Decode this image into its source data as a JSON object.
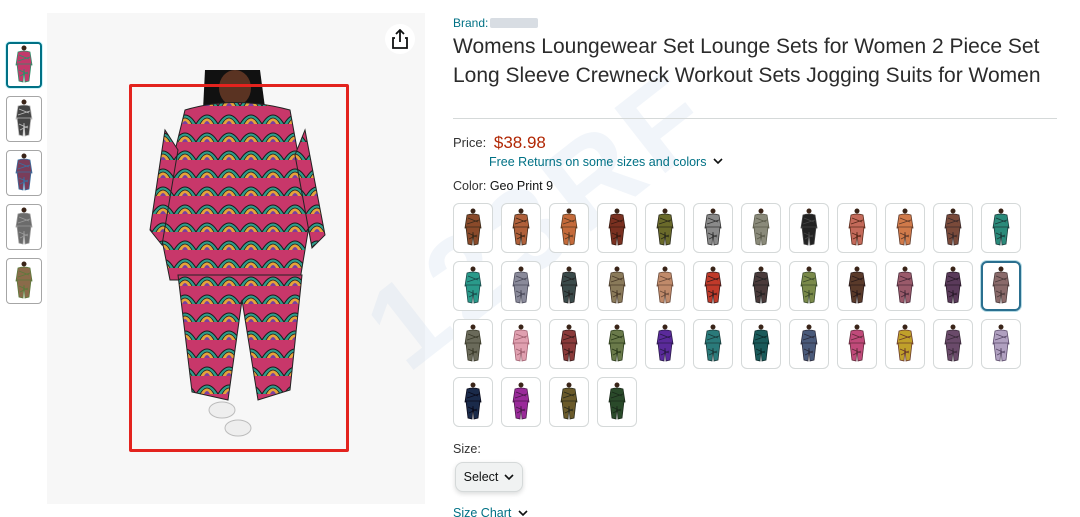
{
  "thumbnails": [
    {
      "name": "thumb-1",
      "colors": [
        "#c23a6b",
        "#2f8f6a",
        "#e0a232"
      ]
    },
    {
      "name": "thumb-2",
      "colors": [
        "#444",
        "#bbb",
        "#777"
      ]
    },
    {
      "name": "thumb-3",
      "colors": [
        "#7a3d5a",
        "#3b6fa0",
        "#d8b14a"
      ]
    },
    {
      "name": "thumb-4",
      "colors": [
        "#6b6b6b",
        "#999",
        "#444"
      ]
    },
    {
      "name": "thumb-5",
      "colors": [
        "#8a6b4a",
        "#5c7a3c",
        "#b94a3a"
      ]
    }
  ],
  "share_icon": "share-icon",
  "product": {
    "brand_label": "Brand:",
    "title": "Womens Loungewear Set Lounge Sets for Women 2 Piece Set Long Sleeve Crewneck Workout Sets Jogging Suits for Women",
    "price_label": "Price:",
    "price": "$38.98",
    "returns_text": "Free Returns on some sizes and colors",
    "color_label": "Color:",
    "color_value": "Geo Print 9",
    "size_label": "Size:",
    "size_select_value": "Select",
    "size_chart_link": "Size Chart",
    "selected_swatch_index": 23
  },
  "swatches": [
    [
      "#8a4a2a",
      "#3a2a1a"
    ],
    [
      "#b0603a",
      "#402818"
    ],
    [
      "#c46a3a",
      "#5a3a20"
    ],
    [
      "#7a3020",
      "#3a1a10"
    ],
    [
      "#6a6a2a",
      "#2a2a1a"
    ],
    [
      "#8a8a8a",
      "#333"
    ],
    [
      "#8a8a7a",
      "#5a5a4a"
    ],
    [
      "#222",
      "#444"
    ],
    [
      "#c46a5a",
      "#5a2a1a"
    ],
    [
      "#d07a4a",
      "#603a2a"
    ],
    [
      "#7a4a3a",
      "#3a2a2a"
    ],
    [
      "#2a8a7a",
      "#1a3a3a"
    ],
    [
      "#2a9a8a",
      "#1a4a4a"
    ],
    [
      "#8a8a9a",
      "#4a4a5a"
    ],
    [
      "#3a4a4a",
      "#222"
    ],
    [
      "#8a7a5a",
      "#4a3a2a"
    ],
    [
      "#c08a6a",
      "#6a4a3a"
    ],
    [
      "#c03a2a",
      "#3a1a1a"
    ],
    [
      "#4a3a3a",
      "#222"
    ],
    [
      "#7a8a4a",
      "#3a4a2a"
    ],
    [
      "#5a3a2a",
      "#2a1a1a"
    ],
    [
      "#9a5a6a",
      "#4a2a3a"
    ],
    [
      "#5a3a5a",
      "#2a1a2a"
    ],
    [
      "#8a6a6a",
      "#4a3a3a"
    ],
    [
      "#6a6a5a",
      "#3a3a2a"
    ],
    [
      "#e0a0b0",
      "#a06070"
    ],
    [
      "#8a3a3a",
      "#3a1a1a"
    ],
    [
      "#6a7a4a",
      "#2a3a1a"
    ],
    [
      "#5a2a9a",
      "#2a1a4a"
    ],
    [
      "#2a7a7a",
      "#1a3a3a"
    ],
    [
      "#1a5a5a",
      "#0a2a2a"
    ],
    [
      "#4a5a7a",
      "#2a2a3a"
    ],
    [
      "#c04a7a",
      "#602a3a"
    ],
    [
      "#c0a02a",
      "#6a3a2a"
    ],
    [
      "#6a4a6a",
      "#3a2a3a"
    ],
    [
      "#b0a0c0",
      "#5a4a6a"
    ],
    [
      "#1a2a4a",
      "#0a0a1a"
    ],
    [
      "#9a2a9a",
      "#4a1a4a"
    ],
    [
      "#6a5a2a",
      "#2a2a1a"
    ],
    [
      "#2a4a2a",
      "#1a2a1a"
    ]
  ],
  "colors": {
    "link": "#007185",
    "price": "#b12704",
    "highlight_box": "#e3231e"
  }
}
